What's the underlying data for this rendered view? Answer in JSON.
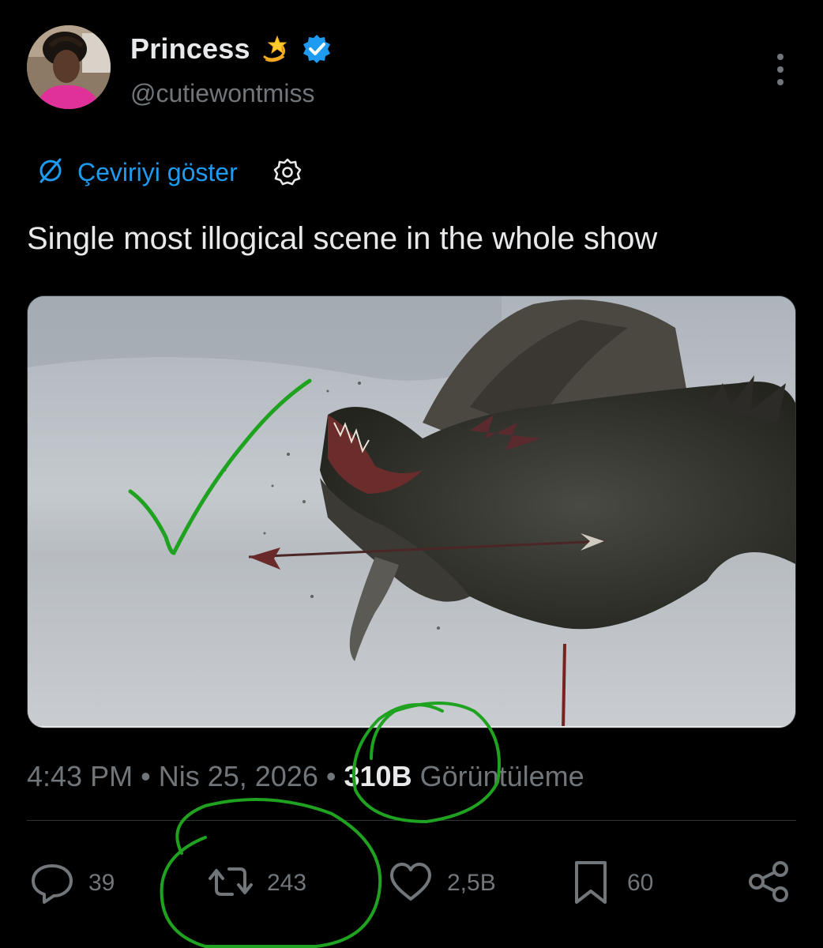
{
  "author": {
    "display_name": "Princess",
    "handle": "@cutiewontmiss",
    "name_emoji": "dizzy-star-icon",
    "verified": true
  },
  "translation": {
    "label": "Çeviriyi göster"
  },
  "tweet": {
    "text": "Single most illogical scene in the whole show"
  },
  "meta": {
    "time": "4:43 PM",
    "separator": "•",
    "date": "Nis 25, 2026",
    "views_count": "310B",
    "views_label": "Görüntüleme"
  },
  "actions": {
    "replies": "39",
    "reposts": "243",
    "likes": "2,5B",
    "bookmarks": "60"
  },
  "colors": {
    "background": "#000000",
    "text": "#e7e9ea",
    "secondary": "#71767b",
    "link": "#1d9bf0",
    "verified": "#1d9bf0",
    "annotation": "#1fa21f"
  }
}
